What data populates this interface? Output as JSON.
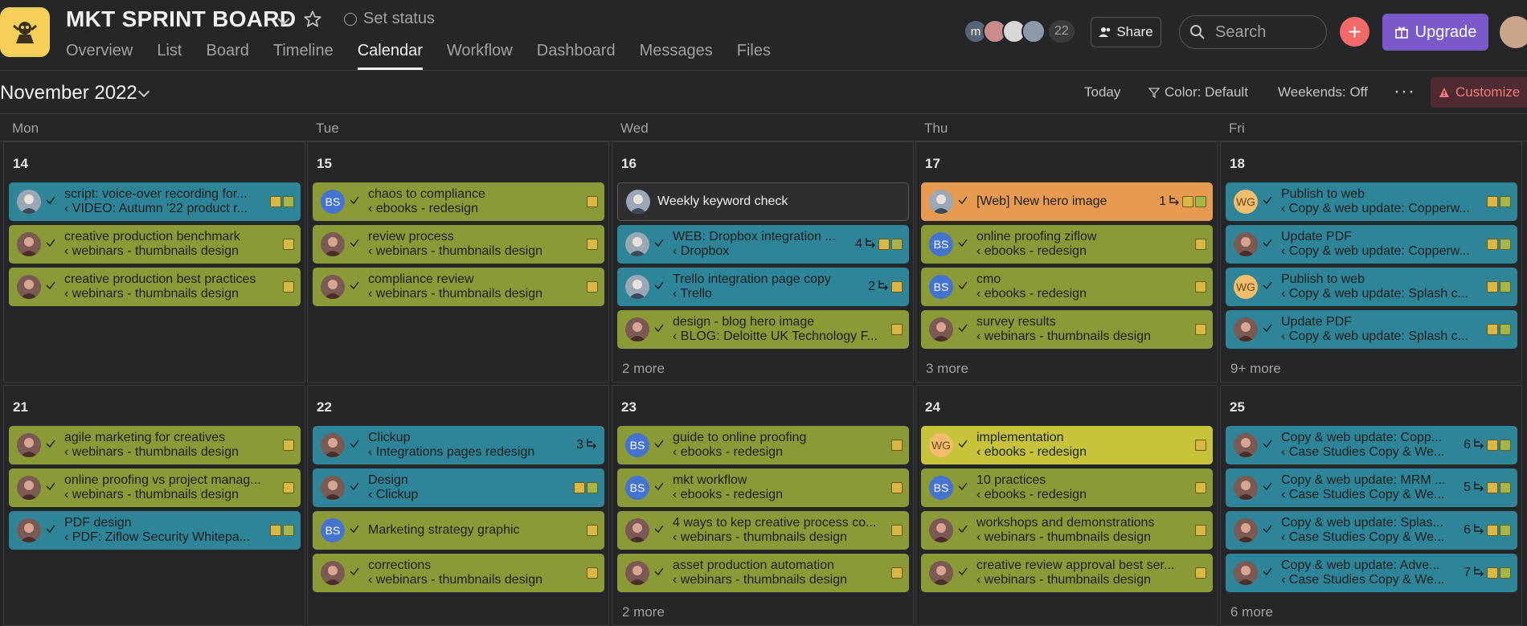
{
  "header": {
    "project_title": "MKT SPRINT BOARD",
    "set_status": "Set status",
    "tabs": [
      "Overview",
      "List",
      "Board",
      "Timeline",
      "Calendar",
      "Workflow",
      "Dashboard",
      "Messages",
      "Files"
    ],
    "active_tab": "Calendar",
    "member_initial": "m",
    "member_count": "22",
    "share_label": "Share",
    "search_placeholder": "Search",
    "upgrade_label": "Upgrade"
  },
  "toolbar": {
    "month": "November 2022",
    "today": "Today",
    "color": "Color: Default",
    "weekends": "Weekends: Off",
    "customize": "Customize"
  },
  "weekdays": [
    "Mon",
    "Tue",
    "Wed",
    "Thu",
    "Fri"
  ],
  "weeks": [
    {
      "days": [
        {
          "num": "14",
          "more": "",
          "tasks": [
            {
              "title": "script: voice-over recording for...",
              "sub": "‹ VIDEO: Autumn '22 product r...",
              "color": "teal",
              "av": "man",
              "count": "",
              "chips": 2
            },
            {
              "title": "creative production benchmark",
              "sub": "‹ webinars - thumbnails design",
              "color": "olive",
              "av": "photo",
              "count": "",
              "chips": 1
            },
            {
              "title": "creative production best practices",
              "sub": "‹ webinars - thumbnails design",
              "color": "olive",
              "av": "photo",
              "count": "",
              "chips": 1
            }
          ]
        },
        {
          "num": "15",
          "more": "",
          "tasks": [
            {
              "title": "chaos to compliance",
              "sub": "‹ ebooks - redesign",
              "color": "olive",
              "av": "bs",
              "count": "",
              "chips": 1
            },
            {
              "title": "review process",
              "sub": "‹ webinars - thumbnails design",
              "color": "olive",
              "av": "photo",
              "count": "",
              "chips": 1
            },
            {
              "title": "compliance review",
              "sub": "‹ webinars - thumbnails design",
              "color": "olive",
              "av": "photo",
              "count": "",
              "chips": 1
            }
          ]
        },
        {
          "num": "16",
          "more": "2 more",
          "tasks": [
            {
              "title": "Weekly keyword check",
              "sub": "",
              "color": "dark",
              "av": "man",
              "count": "",
              "chips": 0
            },
            {
              "title": "WEB: Dropbox integration ...",
              "sub": "‹ Dropbox",
              "color": "teal",
              "av": "man",
              "count": "4",
              "chips": 2
            },
            {
              "title": "Trello integration page copy",
              "sub": "‹ Trello",
              "color": "teal",
              "av": "man",
              "count": "2",
              "chips": 1
            },
            {
              "title": "design - blog hero image",
              "sub": "‹ BLOG: Deloitte UK Technology F...",
              "color": "olive",
              "av": "photo",
              "count": "",
              "chips": 1
            }
          ]
        },
        {
          "num": "17",
          "more": "3 more",
          "tasks": [
            {
              "title": "[Web] New hero image",
              "sub": "",
              "color": "orange",
              "av": "man",
              "count": "1",
              "chips": 2
            },
            {
              "title": "online proofing ziflow",
              "sub": "‹ ebooks - redesign",
              "color": "olive",
              "av": "bs",
              "count": "",
              "chips": 1
            },
            {
              "title": "cmo",
              "sub": "‹ ebooks - redesign",
              "color": "olive",
              "av": "bs",
              "count": "",
              "chips": 1
            },
            {
              "title": "survey results",
              "sub": "‹ webinars - thumbnails design",
              "color": "olive",
              "av": "photo",
              "count": "",
              "chips": 1
            }
          ]
        },
        {
          "num": "18",
          "more": "9+ more",
          "tasks": [
            {
              "title": "Publish to web",
              "sub": "‹ Copy & web update: Copperw...",
              "color": "teal",
              "av": "wg",
              "count": "",
              "chips": 2
            },
            {
              "title": "Update PDF",
              "sub": "‹ Copy & web update: Copperw...",
              "color": "teal",
              "av": "photo",
              "count": "",
              "chips": 2
            },
            {
              "title": "Publish to web",
              "sub": "‹ Copy & web update: Splash c...",
              "color": "teal",
              "av": "wg",
              "count": "",
              "chips": 2
            },
            {
              "title": "Update PDF",
              "sub": "‹ Copy & web update: Splash c...",
              "color": "teal",
              "av": "photo",
              "count": "",
              "chips": 2
            }
          ]
        }
      ]
    },
    {
      "days": [
        {
          "num": "21",
          "more": "",
          "tasks": [
            {
              "title": "agile marketing for creatives",
              "sub": "‹ webinars - thumbnails design",
              "color": "olive",
              "av": "photo",
              "count": "",
              "chips": 1
            },
            {
              "title": "online proofing vs project manag...",
              "sub": "‹ webinars - thumbnails design",
              "color": "olive",
              "av": "photo",
              "count": "",
              "chips": 1
            },
            {
              "title": "PDF design",
              "sub": "‹ PDF: Ziflow Security Whitepa...",
              "color": "teal",
              "av": "photo",
              "count": "",
              "chips": 2
            }
          ]
        },
        {
          "num": "22",
          "more": "",
          "tasks": [
            {
              "title": "Clickup",
              "sub": "‹ Integrations pages redesign",
              "color": "teal",
              "av": "photo",
              "count": "3",
              "chips": 0
            },
            {
              "title": "Design",
              "sub": "‹ Clickup",
              "color": "teal",
              "av": "photo",
              "count": "",
              "chips": 2
            },
            {
              "title": "Marketing strategy graphic",
              "sub": "",
              "color": "olive",
              "av": "bs",
              "count": "",
              "chips": 1
            },
            {
              "title": "corrections",
              "sub": "‹ webinars - thumbnails design",
              "color": "olive",
              "av": "photo",
              "count": "",
              "chips": 1
            }
          ]
        },
        {
          "num": "23",
          "more": "2 more",
          "tasks": [
            {
              "title": "guide to online proofing",
              "sub": "‹ ebooks - redesign",
              "color": "olive",
              "av": "bs",
              "count": "",
              "chips": 1
            },
            {
              "title": "mkt workflow",
              "sub": "‹ ebooks - redesign",
              "color": "olive",
              "av": "bs",
              "count": "",
              "chips": 1
            },
            {
              "title": "4 ways to kep creative process co...",
              "sub": "‹ webinars - thumbnails design",
              "color": "olive",
              "av": "photo",
              "count": "",
              "chips": 1
            },
            {
              "title": "asset production automation",
              "sub": "‹ webinars - thumbnails design",
              "color": "olive",
              "av": "photo",
              "count": "",
              "chips": 1
            }
          ]
        },
        {
          "num": "24",
          "more": "",
          "tasks": [
            {
              "title": "implementation",
              "sub": "‹ ebooks - redesign",
              "color": "yellow",
              "av": "wg",
              "count": "",
              "chips": 1
            },
            {
              "title": "10 practices",
              "sub": "‹ ebooks - redesign",
              "color": "olive",
              "av": "bs",
              "count": "",
              "chips": 1
            },
            {
              "title": "workshops and demonstrations",
              "sub": "‹ webinars - thumbnails design",
              "color": "olive",
              "av": "photo",
              "count": "",
              "chips": 1
            },
            {
              "title": "creative review approval best ser...",
              "sub": "‹ webinars - thumbnails design",
              "color": "olive",
              "av": "photo",
              "count": "",
              "chips": 1
            }
          ]
        },
        {
          "num": "25",
          "more": "6 more",
          "tasks": [
            {
              "title": "Copy & web update: Copp...",
              "sub": "‹ Case Studies Copy & We...",
              "color": "teal",
              "av": "photo",
              "count": "6",
              "chips": 2
            },
            {
              "title": "Copy & web update: MRM ...",
              "sub": "‹ Case Studies Copy & We...",
              "color": "teal",
              "av": "photo",
              "count": "5",
              "chips": 2
            },
            {
              "title": "Copy & web update: Splas...",
              "sub": "‹ Case Studies Copy & We...",
              "color": "teal",
              "av": "photo",
              "count": "6",
              "chips": 2
            },
            {
              "title": "Copy & web update: Adve...",
              "sub": "‹ Case Studies Copy & We...",
              "color": "teal",
              "av": "photo",
              "count": "7",
              "chips": 2
            }
          ]
        }
      ]
    }
  ]
}
